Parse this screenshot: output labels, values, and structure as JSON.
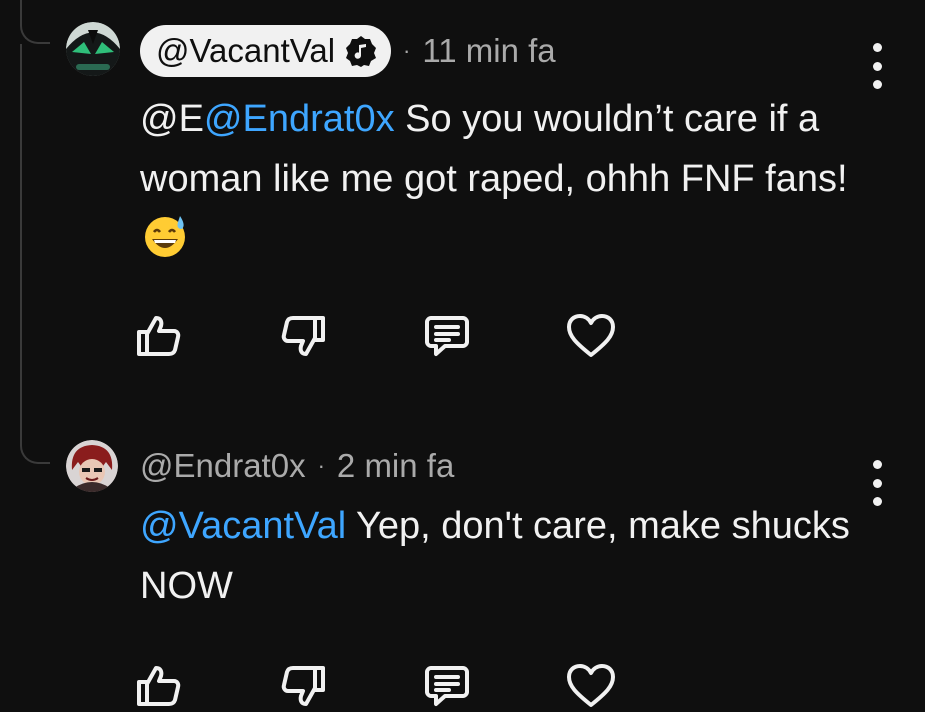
{
  "comments": [
    {
      "handle": "@VacantVal",
      "verified_badge_icon": "music-note-badge-icon",
      "separator": "·",
      "time": "11 min fa",
      "text_prefix": "@E",
      "mention": "@Endrat0x",
      "text_rest": " So you wouldn’t care if a woman like me got raped, ohhh FNF fans!",
      "emoji": "grinning-face-with-sweat-icon",
      "actions": [
        "like-icon",
        "dislike-icon",
        "reply-icon",
        "heart-icon"
      ]
    },
    {
      "handle": "@Endrat0x",
      "separator": "·",
      "time": "2 min fa",
      "mention": "@VacantVal",
      "text_rest": " Yep, don't care, make shucks NOW",
      "actions": [
        "like-icon",
        "dislike-icon",
        "reply-icon",
        "heart-icon"
      ]
    }
  ],
  "colors": {
    "background": "#0f0f0f",
    "text": "#f1f1f1",
    "secondary_text": "#aaaaaa",
    "mention": "#3ea6ff",
    "thread_line": "#3a3a3a"
  }
}
